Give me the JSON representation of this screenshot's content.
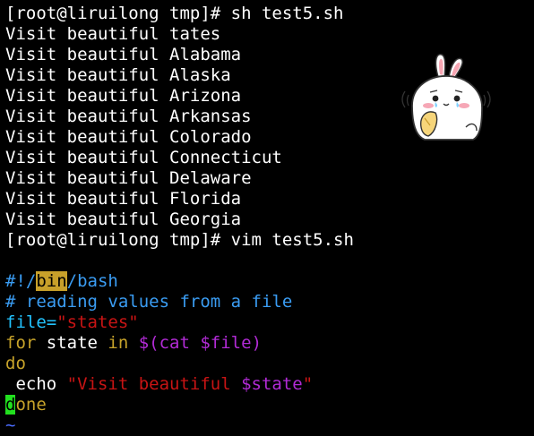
{
  "terminal": {
    "output_lines": [
      "[root@liruilong tmp]# sh test5.sh",
      "Visit beautiful tates",
      "Visit beautiful Alabama",
      "Visit beautiful Alaska",
      "Visit beautiful Arizona",
      "Visit beautiful Arkansas",
      "Visit beautiful Colorado",
      "Visit beautiful Connecticut",
      "Visit beautiful Delaware",
      "Visit beautiful Florida",
      "Visit beautiful Georgia",
      "[root@liruilong tmp]# vim test5.sh"
    ],
    "script": {
      "shebang_prefix": "#!/",
      "shebang_bin": "bin",
      "shebang_suffix": "/bash",
      "comment": "# reading values from a file",
      "assign_var": "file=",
      "assign_value": "\"states\"",
      "for_kw": "for",
      "for_var": " state ",
      "in_kw": "in",
      "for_expr": " $(cat $file)",
      "do_kw": "do",
      "echo_indent": " echo ",
      "echo_string_open": "\"Visit beautiful ",
      "echo_string_var": "$state",
      "echo_string_close": "\"",
      "done_first": "d",
      "done_rest": "one",
      "tilde": "~"
    }
  },
  "colors": {
    "background": "#000000",
    "text": "#ffffff",
    "comment": "#3a9cf2",
    "variable": "#22c3ff",
    "string": "#c81414",
    "keyword": "#c7a32a",
    "substitution": "#b22bd6",
    "search_highlight": "#c8a02a",
    "cursor": "#22e01f",
    "tilde": "#4a6cff"
  },
  "sticker": {
    "icon": "crying-bunny-sticker"
  }
}
